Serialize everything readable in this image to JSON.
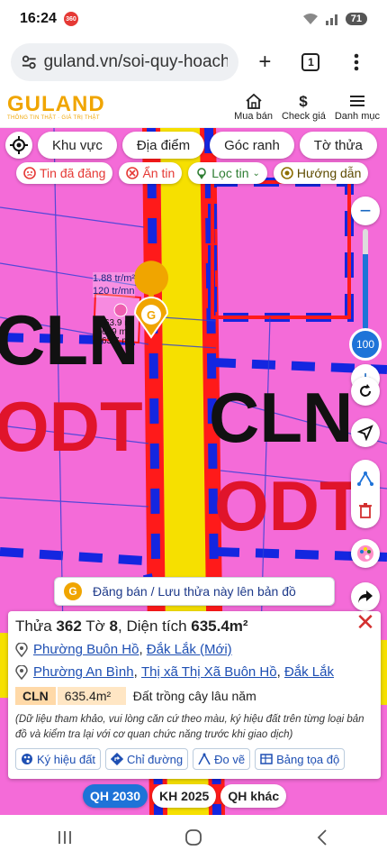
{
  "status": {
    "time": "16:24",
    "notif_badge": "360",
    "battery": "71"
  },
  "browser": {
    "url": "guland.vn/soi-quy-hoach/c",
    "tab_count": "1"
  },
  "site": {
    "logo": "GULAND",
    "tagline": "THÔNG TIN THẬT · GIÁ TRỊ THẬT",
    "actions": [
      {
        "label": "Mua bán",
        "icon": "house-icon"
      },
      {
        "label": "Check giá",
        "icon": "dollar-icon"
      },
      {
        "label": "Danh mục",
        "icon": "menu-icon"
      }
    ]
  },
  "map": {
    "filters": [
      "Khu vực",
      "Địa điểm",
      "Góc ranh",
      "Tờ thửa"
    ],
    "chips": [
      {
        "label": "Tin đã đăng",
        "icon": "posted-icon",
        "color": "#e53935"
      },
      {
        "label": "Ẩn tin",
        "icon": "hide-icon",
        "color": "#e53935"
      },
      {
        "label": "Lọc tin",
        "icon": "filter-icon",
        "color": "#2e7d32"
      },
      {
        "label": "Hướng dẫn",
        "icon": "guide-icon",
        "color": "#8d6e00"
      }
    ],
    "zoom_level": "100",
    "price_per_m2": "1.88 tr/m²",
    "price_total": "120 tr/mn",
    "dimensions": [
      "63.9 m",
      "639 m",
      "63.7 m"
    ],
    "labels": [
      "CLN",
      "ODT",
      "CLN",
      "ODT"
    ],
    "post_banner": "Đăng bán / Lưu thửa này lên bản đồ",
    "colors": {
      "cln": "#f46bd8",
      "road_border": "#ff1a1a",
      "road_blue": "#1426e0",
      "yellow": "#f6e000"
    }
  },
  "parcel": {
    "thua_label": "Thửa",
    "thua": "362",
    "to_label": "Tờ",
    "to": "8",
    "area_label": "Diện tích",
    "area": "635.4m²",
    "address_new": {
      "ward": "Phường Buôn Hồ",
      "sep": ",",
      "province": "Đắk Lắk (Mới)"
    },
    "address_old": {
      "ward": "Phường An Bình",
      "sep1": ",",
      "town": "Thị xã Thị Xã Buôn Hồ",
      "sep2": ",",
      "province": "Đắk Lắk"
    },
    "land_code": "CLN",
    "land_area": "635.4m²",
    "land_name": "Đất trồng cây lâu năm",
    "disclaimer": "(Dữ liệu tham khảo, vui lòng căn cứ theo màu, ký hiệu đất trên từng loại bản đồ và kiểm tra lại với cơ quan chức năng trước khi giao dịch)",
    "actions": [
      {
        "label": "Ký hiệu đất",
        "icon": "palette-icon"
      },
      {
        "label": "Chỉ đường",
        "icon": "directions-icon"
      },
      {
        "label": "Đo vẽ",
        "icon": "measure-icon"
      },
      {
        "label": "Bảng tọa độ",
        "icon": "table-icon"
      }
    ]
  },
  "plan_tabs": [
    "QH 2030",
    "KH 2025",
    "QH khác"
  ]
}
